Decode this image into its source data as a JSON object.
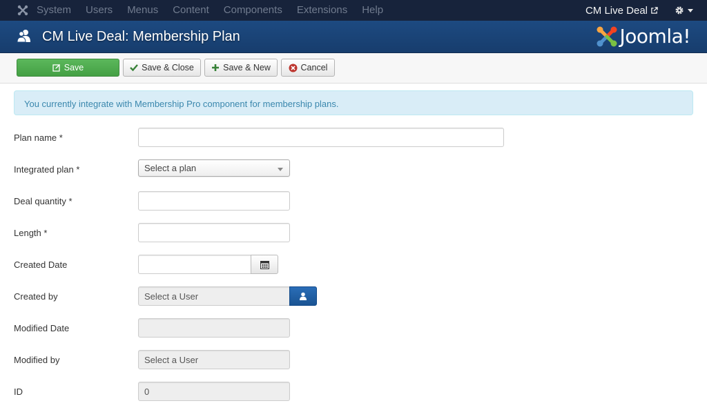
{
  "navbar": {
    "menu": [
      "System",
      "Users",
      "Menus",
      "Content",
      "Components",
      "Extensions",
      "Help"
    ],
    "site_link": "CM Live Deal"
  },
  "header": {
    "title": "CM Live Deal: Membership Plan",
    "brand": "Joomla!"
  },
  "toolbar": {
    "save": "Save",
    "save_close": "Save & Close",
    "save_new": "Save & New",
    "cancel": "Cancel"
  },
  "alert": "You currently integrate with Membership Pro component for membership plans.",
  "form": {
    "plan_name": {
      "label": "Plan name *",
      "value": ""
    },
    "integrated_plan": {
      "label": "Integrated plan *",
      "value": "Select a plan"
    },
    "deal_quantity": {
      "label": "Deal quantity *",
      "value": ""
    },
    "length": {
      "label": "Length *",
      "value": ""
    },
    "created_date": {
      "label": "Created Date",
      "value": ""
    },
    "created_by": {
      "label": "Created by",
      "value": "Select a User"
    },
    "modified_date": {
      "label": "Modified Date",
      "value": ""
    },
    "modified_by": {
      "label": "Modified by",
      "value": "Select a User"
    },
    "id": {
      "label": "ID",
      "value": "0"
    }
  },
  "colors": {
    "navbar": "#17233b",
    "header": "#1d4a81",
    "save_button": "#5cb85c",
    "alert_bg": "#d9edf7",
    "alert_text": "#3a87ad"
  },
  "icons": [
    "joomla-icon",
    "external-link-icon",
    "gear-icon",
    "users-icon",
    "edit-icon",
    "check-icon",
    "plus-icon",
    "cancel-circle-icon",
    "calendar-icon",
    "user-icon"
  ]
}
